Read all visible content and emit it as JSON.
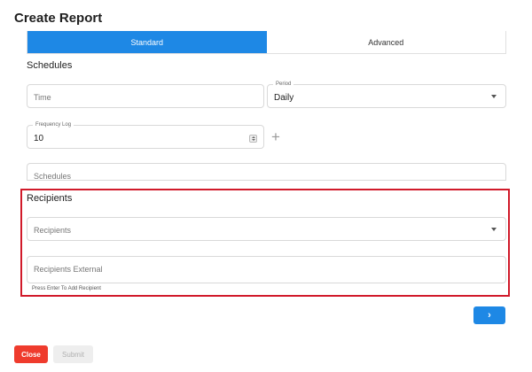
{
  "page": {
    "title": "Create Report"
  },
  "tabs": [
    {
      "label": "Standard",
      "active": true
    },
    {
      "label": "Advanced",
      "active": false
    }
  ],
  "schedules": {
    "heading": "Schedules",
    "time": {
      "placeholder": "Time"
    },
    "period": {
      "label": "Period",
      "value": "Daily"
    },
    "frequency": {
      "label": "Frequency Log",
      "value": "10"
    },
    "schedules_field": {
      "placeholder": "Schedules"
    }
  },
  "recipients": {
    "heading": "Recipients",
    "recipients_select": {
      "placeholder": "Recipients"
    },
    "external": {
      "placeholder": "Recipients External",
      "hint": "Press Enter To Add Recipient"
    }
  },
  "buttons": {
    "next_icon": "chevron-right-icon",
    "next_symbol": "›",
    "close": "Close",
    "submit": "Submit"
  },
  "colors": {
    "accent": "#1e88e5",
    "danger": "#ef3b2d",
    "highlight": "#d11a2a",
    "disabled": "#eeeeee"
  }
}
